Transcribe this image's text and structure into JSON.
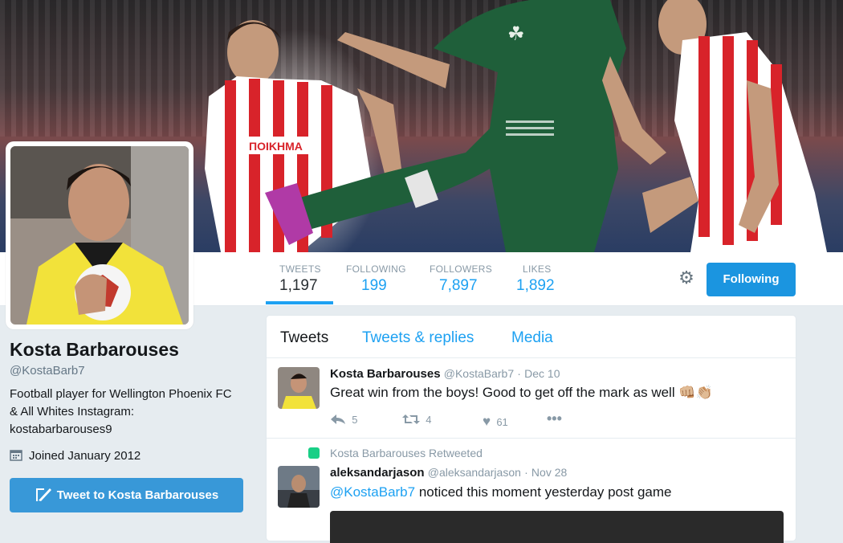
{
  "profile": {
    "name": "Kosta Barbarouses",
    "handle": "@KostaBarb7",
    "bio": "Football player for Wellington Phoenix FC & All Whites Instagram: kostabarbarouses9",
    "joined": "Joined January 2012",
    "tweet_to_label": "Tweet to Kosta Barbarouses"
  },
  "stats": [
    {
      "label": "TWEETS",
      "value": "1,197"
    },
    {
      "label": "FOLLOWING",
      "value": "199"
    },
    {
      "label": "FOLLOWERS",
      "value": "7,897"
    },
    {
      "label": "LIKES",
      "value": "1,892"
    }
  ],
  "follow_button": "Following",
  "tabs": [
    "Tweets",
    "Tweets & replies",
    "Media"
  ],
  "tweets": [
    {
      "name": "Kosta Barbarouses",
      "handle": "@KostaBarb7",
      "date": "Dec 10",
      "text": "Great win from the boys! Good to get off the mark as well",
      "emoji": "👊🏼👏🏼",
      "replies": "5",
      "retweets": "4",
      "likes": "61"
    },
    {
      "retweeted_by": "Kosta Barbarouses Retweeted",
      "name": "aleksandarjason",
      "handle": "@aleksandarjason",
      "date": "Nov 28",
      "mention": "@KostaBarb7",
      "text": " noticed this moment yesterday post game"
    }
  ],
  "colors": {
    "accent": "#1da1f2",
    "button": "#1b95e0",
    "retweet_green": "#19cf86"
  }
}
